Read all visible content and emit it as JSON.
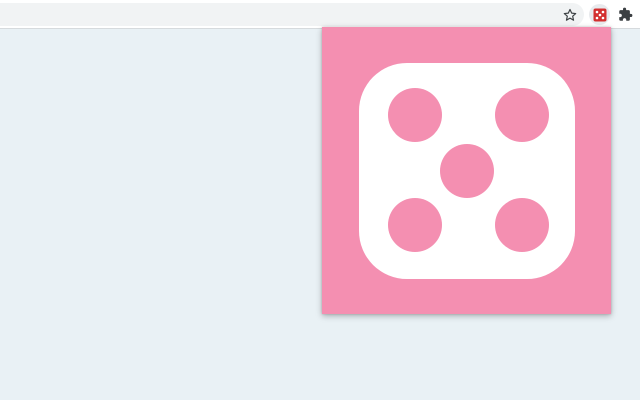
{
  "browser": {
    "address_bar": {
      "value": ""
    },
    "toolbar_icons": {
      "bookmark": "star-icon",
      "extension": "dice-icon",
      "extensions_menu": "puzzle-icon"
    }
  },
  "popup": {
    "content": "dice-face-five",
    "pips": 5,
    "colors": {
      "background": "#f48fb1",
      "die": "#ffffff",
      "pip": "#f48fb1",
      "extension_icon": "#d32f2f"
    }
  }
}
